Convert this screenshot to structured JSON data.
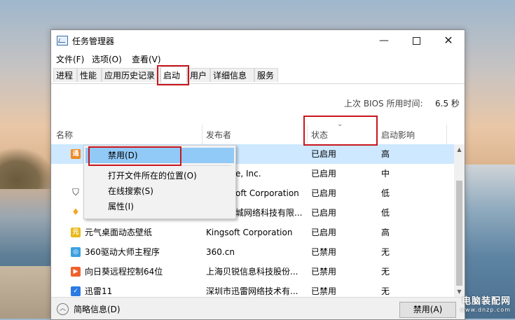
{
  "window": {
    "title": "任务管理器",
    "controls": {
      "minimize": "—",
      "close": "✕"
    }
  },
  "menu": [
    "文件(F)",
    "选项(O)",
    "查看(V)"
  ],
  "tabs": [
    "进程",
    "性能",
    "应用历史记录",
    "启动",
    "用户",
    "详细信息",
    "服务"
  ],
  "active_tab": "启动",
  "bios": {
    "label": "上次 BIOS 所用时间:",
    "value": "6.5 秒"
  },
  "columns": {
    "name": "名称",
    "publisher": "发布者",
    "status": "状态",
    "impact": "启动影响"
  },
  "rows": [
    {
      "name": "",
      "publisher": "",
      "status": "已启用",
      "impact": "高",
      "icon": "app-orange-icon",
      "icon_color": "#f08a24",
      "icon_glyph": "通"
    },
    {
      "name": "",
      "publisher": "e, Inc.",
      "status": "已启用",
      "impact": "中",
      "icon": "",
      "icon_color": "",
      "icon_glyph": ""
    },
    {
      "name": "",
      "publisher": "oft Corporation",
      "status": "已启用",
      "impact": "低",
      "icon": "shield-icon",
      "icon_color": "#333333",
      "icon_glyph": "⛉"
    },
    {
      "name": "",
      "publisher": "城网络科技有限...",
      "status": "已启用",
      "impact": "低",
      "icon": "flame-icon",
      "icon_color": "#f5a623",
      "icon_glyph": "♦"
    },
    {
      "name": "元气桌面动态壁纸",
      "publisher": "Kingsoft Corporation",
      "status": "已启用",
      "impact": "高",
      "icon": "wallpaper-app-icon",
      "icon_color": "#e9b81c",
      "icon_glyph": "元"
    },
    {
      "name": "360驱动大师主程序",
      "publisher": "360.cn",
      "status": "已禁用",
      "impact": "无",
      "icon": "driver-master-icon",
      "icon_color": "#3aa0e0",
      "icon_glyph": "◎"
    },
    {
      "name": "向日葵远程控制64位",
      "publisher": "上海贝锐信息科技股份...",
      "status": "已禁用",
      "impact": "无",
      "icon": "sunflower-icon",
      "icon_color": "#f0612c",
      "icon_glyph": "▶"
    },
    {
      "name": "迅雷11",
      "publisher": "深圳市迅雷网络技术有...",
      "status": "已禁用",
      "impact": "无",
      "icon": "thunder-icon",
      "icon_color": "#2b7be4",
      "icon_glyph": "✓"
    }
  ],
  "context_menu": [
    "禁用(D)",
    "打开文件所在的位置(O)",
    "在线搜索(S)",
    "属性(I)"
  ],
  "footer": {
    "fewer_details": "简略信息(D)",
    "disable_button": "禁用(A)"
  },
  "watermark": {
    "main": "电脑装配网",
    "sub": "www.dnzp.com"
  }
}
